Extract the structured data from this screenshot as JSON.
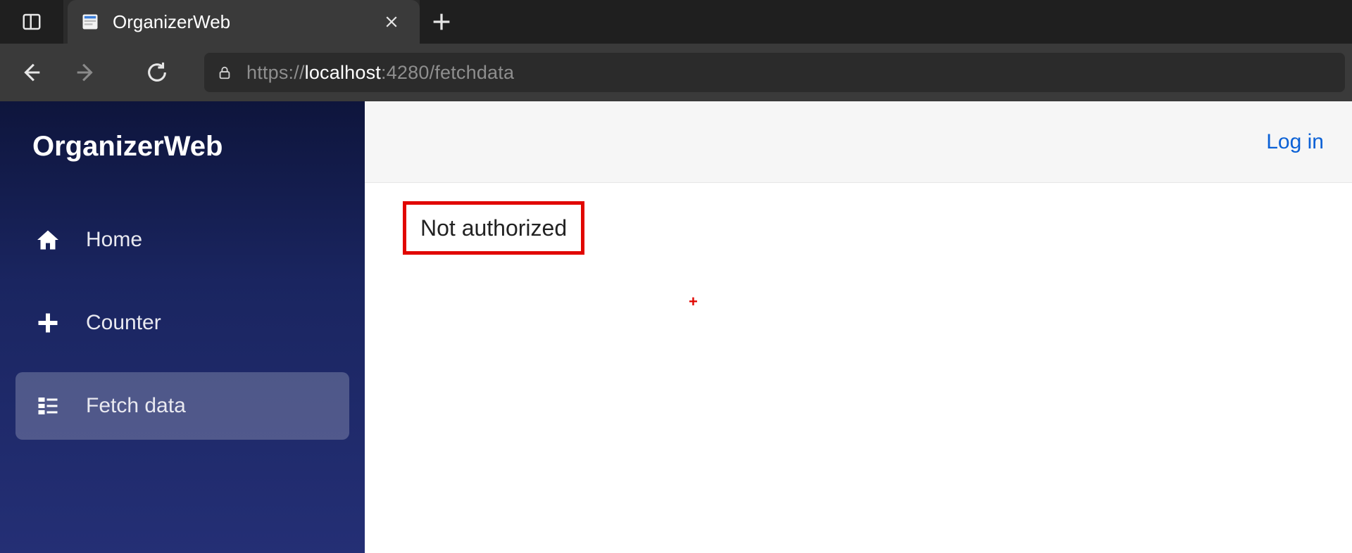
{
  "browser": {
    "tab_title": "OrganizerWeb",
    "url_scheme": "https://",
    "url_host": "localhost",
    "url_port": ":4280",
    "url_path": "/fetchdata"
  },
  "app": {
    "brand": "OrganizerWeb",
    "topbar": {
      "login_label": "Log in"
    },
    "sidebar": {
      "items": [
        {
          "label": "Home"
        },
        {
          "label": "Counter"
        },
        {
          "label": "Fetch data"
        }
      ]
    },
    "content": {
      "unauthorized_message": "Not authorized",
      "red_plus": "+"
    }
  }
}
